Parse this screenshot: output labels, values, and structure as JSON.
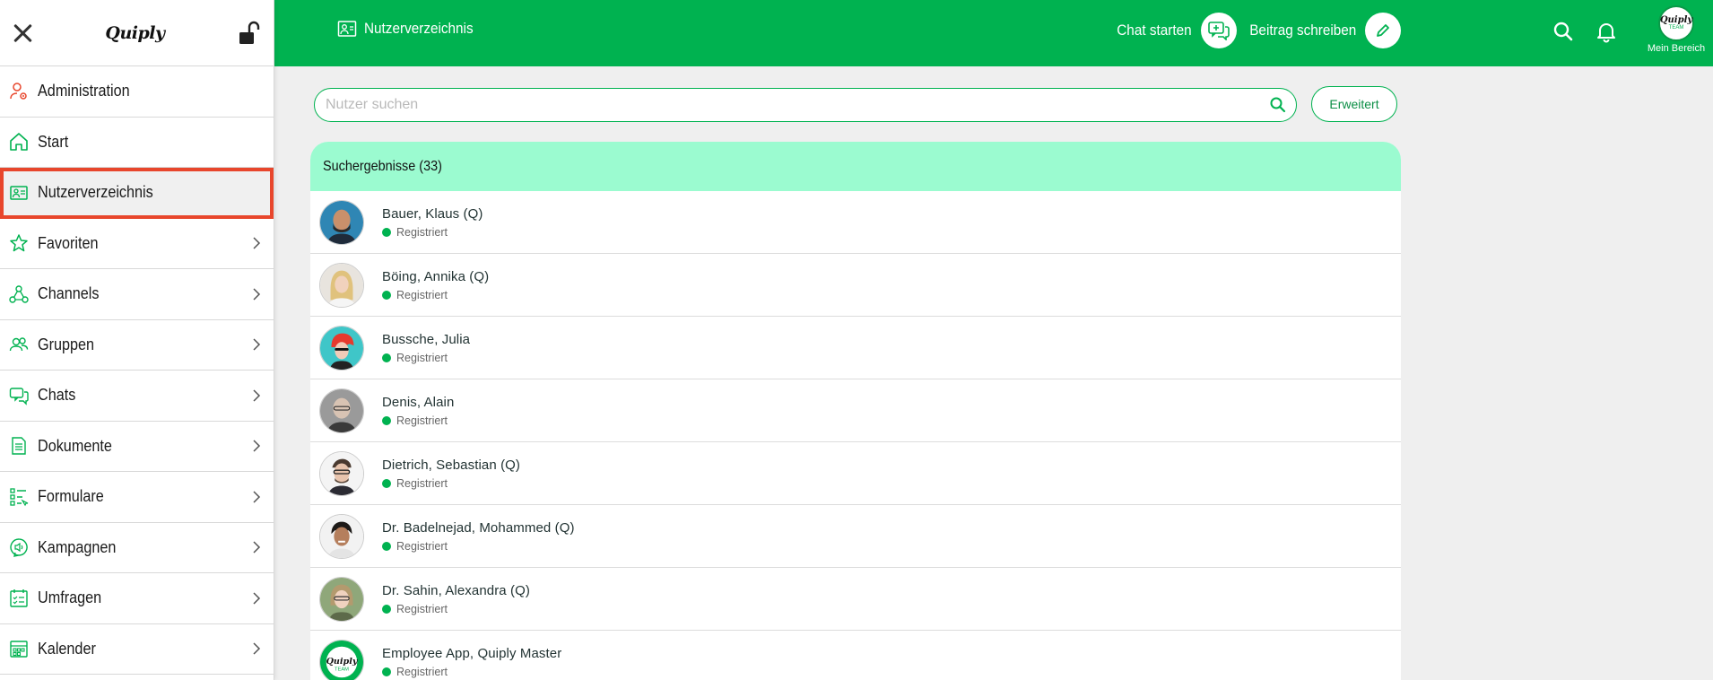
{
  "sidebar": {
    "logo": "Quiply",
    "items": [
      {
        "label": "Administration",
        "icon": "admin-user-icon",
        "chevron": false,
        "active": false
      },
      {
        "label": "Start",
        "icon": "home-icon",
        "chevron": false,
        "active": false
      },
      {
        "label": "Nutzerverzeichnis",
        "icon": "directory-icon",
        "chevron": false,
        "active": true
      },
      {
        "label": "Favoriten",
        "icon": "star-icon",
        "chevron": true,
        "active": false
      },
      {
        "label": "Channels",
        "icon": "channels-icon",
        "chevron": true,
        "active": false
      },
      {
        "label": "Gruppen",
        "icon": "groups-icon",
        "chevron": true,
        "active": false
      },
      {
        "label": "Chats",
        "icon": "chats-icon",
        "chevron": true,
        "active": false
      },
      {
        "label": "Dokumente",
        "icon": "document-icon",
        "chevron": true,
        "active": false
      },
      {
        "label": "Formulare",
        "icon": "forms-icon",
        "chevron": true,
        "active": false
      },
      {
        "label": "Kampagnen",
        "icon": "campaign-icon",
        "chevron": true,
        "active": false
      },
      {
        "label": "Umfragen",
        "icon": "survey-icon",
        "chevron": true,
        "active": false
      },
      {
        "label": "Kalender",
        "icon": "calendar-icon",
        "chevron": true,
        "active": false
      }
    ]
  },
  "header": {
    "title": "Nutzerverzeichnis",
    "chat_label": "Chat starten",
    "post_label": "Beitrag schreiben",
    "me_logo": "Quiply",
    "me_team": "TEAM",
    "me_label": "Mein Bereich"
  },
  "search": {
    "placeholder": "Nutzer suchen",
    "value": "",
    "advanced_label": "Erweitert"
  },
  "results": {
    "title": "Suchergebnisse (33)",
    "status_label": "Registriert",
    "users": [
      {
        "name": "Bauer, Klaus (Q)",
        "status": "Registriert",
        "avatar": "man-bald-beard"
      },
      {
        "name": "Böing, Annika (Q)",
        "status": "Registriert",
        "avatar": "woman-blonde"
      },
      {
        "name": "Bussche, Julia",
        "status": "Registriert",
        "avatar": "woman-red-hair-illustration"
      },
      {
        "name": "Denis, Alain",
        "status": "Registriert",
        "avatar": "man-glasses"
      },
      {
        "name": "Dietrich, Sebastian (Q)",
        "status": "Registriert",
        "avatar": "man-glasses-beard"
      },
      {
        "name": "Dr. Badelnejad, Mohammed (Q)",
        "status": "Registriert",
        "avatar": "man-dark-hair"
      },
      {
        "name": "Dr. Sahin, Alexandra (Q)",
        "status": "Registriert",
        "avatar": "woman-glasses"
      },
      {
        "name": "Employee App, Quiply Master",
        "status": "Registriert",
        "avatar": "quiply-team-logo"
      }
    ]
  },
  "colors": {
    "brand_green": "#00b250",
    "results_header": "#9bfbd0",
    "active_outline": "#e8462c",
    "status_dot": "#00b250"
  }
}
